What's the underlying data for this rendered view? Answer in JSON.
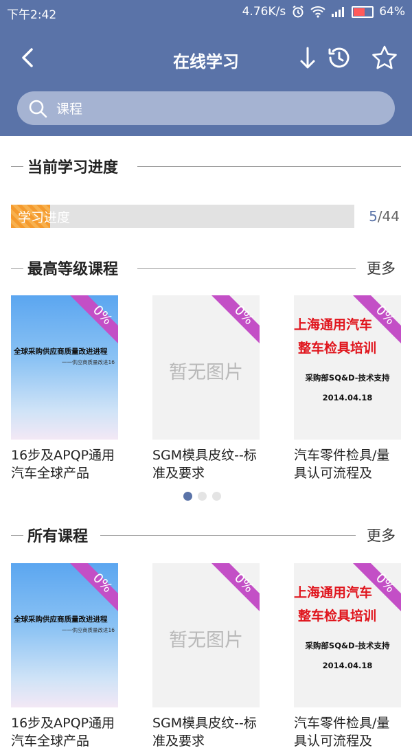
{
  "status_bar": {
    "time": "下午2:42",
    "network_speed": "4.76K/s",
    "battery": "64%"
  },
  "header": {
    "title": "在线学习"
  },
  "search": {
    "placeholder": "课程"
  },
  "progress_section": {
    "title": "当前学习进度",
    "bar_label": "学习进度",
    "current": "5",
    "total": "/44",
    "fraction": 0.1136
  },
  "top_courses": {
    "title": "最高等级课程",
    "more": "更多",
    "items": [
      {
        "title": "16步及APQP通用汽车全球产品",
        "badge": "0%",
        "thumb_line1": "全球采购供应商质量改进进程",
        "thumb_line2": "一一供应商质量改进16"
      },
      {
        "title": "SGM模具皮纹--标准及要求",
        "badge": "0%",
        "thumb_text": "暂无图片"
      },
      {
        "title": "汽车零件检具/量具认可流程及",
        "badge": "0%",
        "thumb_line1": "上海通用汽车",
        "thumb_line2": "整车检具培训",
        "thumb_line3": "采购部SQ&D-技术支持",
        "thumb_line4": "2014.04.18"
      }
    ]
  },
  "all_courses": {
    "title": "所有课程",
    "more": "更多",
    "items": [
      {
        "title": "16步及APQP通用汽车全球产品",
        "badge": "0%",
        "thumb_line1": "全球采购供应商质量改进进程",
        "thumb_line2": "一一供应商质量改进16"
      },
      {
        "title": "SGM模具皮纹--标准及要求",
        "badge": "0%",
        "thumb_text": "暂无图片"
      },
      {
        "title": "汽车零件检具/量具认可流程及",
        "badge": "0%",
        "thumb_line1": "上海通用汽车",
        "thumb_line2": "整车检具培训",
        "thumb_line3": "采购部SQ&D-技术支持",
        "thumb_line4": "2014.04.18"
      }
    ]
  },
  "carousel": {
    "pages": 3,
    "active": 0
  },
  "colors": {
    "primary": "#5a73a8",
    "progress": "#f59a2d",
    "ribbon": "#c34fc6"
  }
}
